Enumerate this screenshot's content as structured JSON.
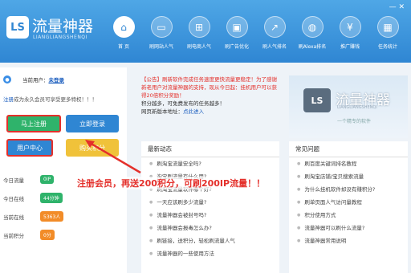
{
  "header": {
    "logo_text": "LS",
    "title": "流量神器",
    "subtitle": "LIANGLIANGSHENQI",
    "window_controls": "— ✕",
    "nav": [
      {
        "label": "首 页",
        "icon": "home-icon",
        "glyph": "⌂"
      },
      {
        "label": "刷网站人气",
        "icon": "monitor-icon",
        "glyph": "▭"
      },
      {
        "label": "刷电商人气",
        "icon": "cart-icon",
        "glyph": "⊞"
      },
      {
        "label": "刷广告优化",
        "icon": "monitor-icon",
        "glyph": "▣"
      },
      {
        "label": "刷人气排名",
        "icon": "chart-icon",
        "glyph": "↗"
      },
      {
        "label": "刷Alexa排名",
        "icon": "globe-icon",
        "glyph": "◍"
      },
      {
        "label": "推广赚钱",
        "icon": "money-icon",
        "glyph": "¥"
      },
      {
        "label": "任务统计",
        "icon": "grid-icon",
        "glyph": "▦"
      }
    ]
  },
  "user": {
    "current_label": "当前用户：",
    "login_link": "未登录",
    "register_tip_link": "注册",
    "register_tip_rest": "成为永久会员可享受更多特权！！！"
  },
  "buttons": {
    "register": "马上注册",
    "login": "立即登录",
    "user_center": "用户中心",
    "buy_points": "购买积分"
  },
  "stats": [
    {
      "label": "今日流量",
      "value": "0IP",
      "color": "green"
    },
    {
      "label": "今日在线",
      "value": "44分钟",
      "color": "green"
    },
    {
      "label": "当前在线",
      "value": "5363人",
      "color": "orange"
    },
    {
      "label": "当前积分",
      "value": "0分",
      "color": "orange"
    }
  ],
  "notice": {
    "tag": "【公告】",
    "line1": "刷新软件完成任务速度更快流量更稳定！为了感谢新老用户对流量神器的支持，现从今日起：",
    "red": "挂机用户可以获得20倍积分奖励！",
    "line2": "积分越多，可免费发布的任务越多！",
    "line3": "网页新版本地址：",
    "link": "点此进入"
  },
  "banner": {
    "logo": "LS",
    "title": "流量神器",
    "en": "LIANGLIANGSHENQI",
    "slogan": "一个精专的软件"
  },
  "news": {
    "title": "最新动态",
    "items": [
      "刷淘宝流量安全吗?",
      "淘宝刷流量有什么用?",
      "刷淘宝流量软件哪个好?",
      "一天应该刷多少流量?",
      "流量神器会被封号吗?",
      "流量神器会报毒怎么办?",
      "刷链接，送积分，轻松刷流量人气",
      "流量神器的一些使用方法"
    ]
  },
  "faq": {
    "title": "常见问题",
    "items": [
      "刷百度关键词排名教程",
      "刷淘宝店铺/宝贝搜索流量",
      "为什么挂机软件却没有赚积分?",
      "刷单页面人气访问量教程",
      "积分使用方式",
      "流量神器可以刷什么流量?",
      "流量神器常用说明"
    ]
  },
  "promo": "注册会员，再送200积分，可刷200IP流量！！"
}
